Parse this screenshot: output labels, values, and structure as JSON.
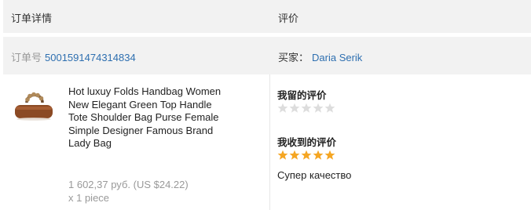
{
  "header": {
    "order_details": "订单详情",
    "reviews": "评价"
  },
  "order": {
    "number_label": "订单号",
    "number": "5001591474314834"
  },
  "buyer": {
    "label": "买家：",
    "name": "Daria Serik"
  },
  "product": {
    "title": "Hot luxuy Folds Handbag Women New Elegant Green Top Handle Tote Shoulder Bag Purse Female Simple Designer Famous Brand Lady Bag",
    "price": "1 602,37 руб. (US $24.22)",
    "quantity": "x 1 piece",
    "thumbnail": "handbag-thumbnail"
  },
  "my_review": {
    "label": "我留的评价",
    "stars": 0,
    "max": 5
  },
  "received_review": {
    "label": "我收到的评价",
    "stars": 5,
    "max": 5,
    "comment": "Супер качество"
  },
  "colors": {
    "link": "#2e6fb0",
    "star_filled": "#f5a623",
    "star_empty": "#dddddd",
    "band": "#f2f2f2"
  }
}
